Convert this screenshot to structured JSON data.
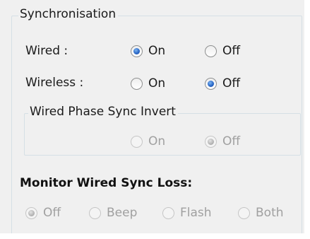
{
  "synchronisation": {
    "group_title": "Synchronisation",
    "wired": {
      "label": "Wired :",
      "on": "On",
      "off": "Off",
      "selected": "On"
    },
    "wireless": {
      "label": "Wireless :",
      "on": "On",
      "off": "Off",
      "selected": "Off"
    },
    "wired_phase_sync_invert": {
      "group_title": "Wired Phase Sync Invert",
      "on": "On",
      "off": "Off",
      "selected": "Off",
      "enabled": false
    },
    "monitor_wired_sync_loss": {
      "label": "Monitor Wired Sync Loss:",
      "options": [
        "Off",
        "Beep",
        "Flash",
        "Both"
      ],
      "selected": "Off",
      "enabled": false
    }
  }
}
